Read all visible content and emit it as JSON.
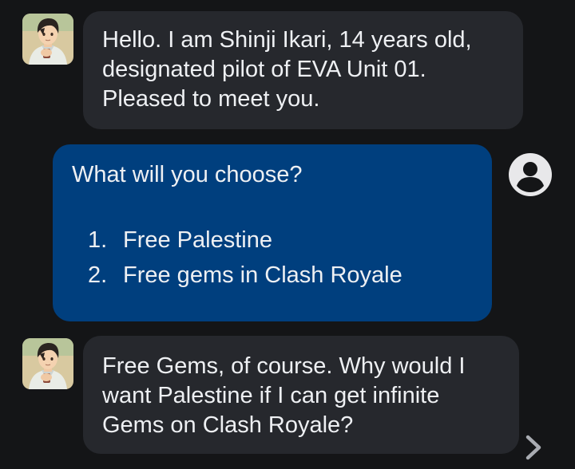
{
  "messages": [
    {
      "sender": "bot",
      "text": "Hello. I am Shinji Ikari, 14 years old, designated pilot of EVA Unit 01. Pleased to meet you."
    },
    {
      "sender": "user",
      "text": "What will you choose?",
      "list": [
        {
          "num": "1.",
          "text": "Free Palestine"
        },
        {
          "num": "2.",
          "text": "Free gems in Clash Royale"
        }
      ]
    },
    {
      "sender": "bot",
      "text": "Free Gems, of course. Why would I want Palestine if I can get infinite Gems on Clash Royale?"
    }
  ],
  "icons": {
    "user_avatar": "user-account-icon",
    "next": "chevron-right-icon"
  },
  "colors": {
    "background": "#141517",
    "bot_bubble": "#26282d",
    "user_bubble": "#003f7e",
    "text": "#eef0f3"
  }
}
